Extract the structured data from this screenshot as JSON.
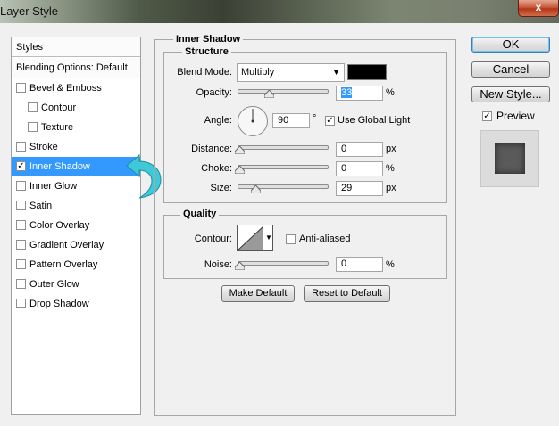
{
  "window": {
    "title": "Layer Style",
    "close_glyph": "x"
  },
  "sidebar": {
    "header": "Styles",
    "blending": "Blending Options: Default",
    "items": [
      {
        "label": "Bevel & Emboss",
        "checked": false
      },
      {
        "label": "Contour",
        "checked": false
      },
      {
        "label": "Texture",
        "checked": false
      },
      {
        "label": "Stroke",
        "checked": false
      },
      {
        "label": "Inner Shadow",
        "checked": true
      },
      {
        "label": "Inner Glow",
        "checked": false
      },
      {
        "label": "Satin",
        "checked": false
      },
      {
        "label": "Color Overlay",
        "checked": false
      },
      {
        "label": "Gradient Overlay",
        "checked": false
      },
      {
        "label": "Pattern Overlay",
        "checked": false
      },
      {
        "label": "Outer Glow",
        "checked": false
      },
      {
        "label": "Drop Shadow",
        "checked": false
      }
    ],
    "selected_color": "#3399ff",
    "arrow_color": "#3fc8d8"
  },
  "panel": {
    "title": "Inner Shadow",
    "structure": {
      "legend": "Structure",
      "blend_mode_label": "Blend Mode:",
      "blend_mode_value": "Multiply",
      "color_swatch": "#000000",
      "opacity_label": "Opacity:",
      "opacity_value": "33",
      "opacity_unit": "%",
      "angle_label": "Angle:",
      "angle_value": "90",
      "angle_unit": "°",
      "global_light_label": "Use Global Light",
      "global_light_checked": true,
      "distance_label": "Distance:",
      "distance_value": "0",
      "distance_unit": "px",
      "choke_label": "Choke:",
      "choke_value": "0",
      "choke_unit": "%",
      "size_label": "Size:",
      "size_value": "29",
      "size_unit": "px"
    },
    "quality": {
      "legend": "Quality",
      "contour_label": "Contour:",
      "antialiased_label": "Anti-aliased",
      "antialiased_checked": false,
      "noise_label": "Noise:",
      "noise_value": "0",
      "noise_unit": "%"
    },
    "make_default": "Make Default",
    "reset_default": "Reset to Default"
  },
  "actions": {
    "ok": "OK",
    "cancel": "Cancel",
    "new_style": "New Style...",
    "preview_label": "Preview",
    "preview_checked": true
  }
}
